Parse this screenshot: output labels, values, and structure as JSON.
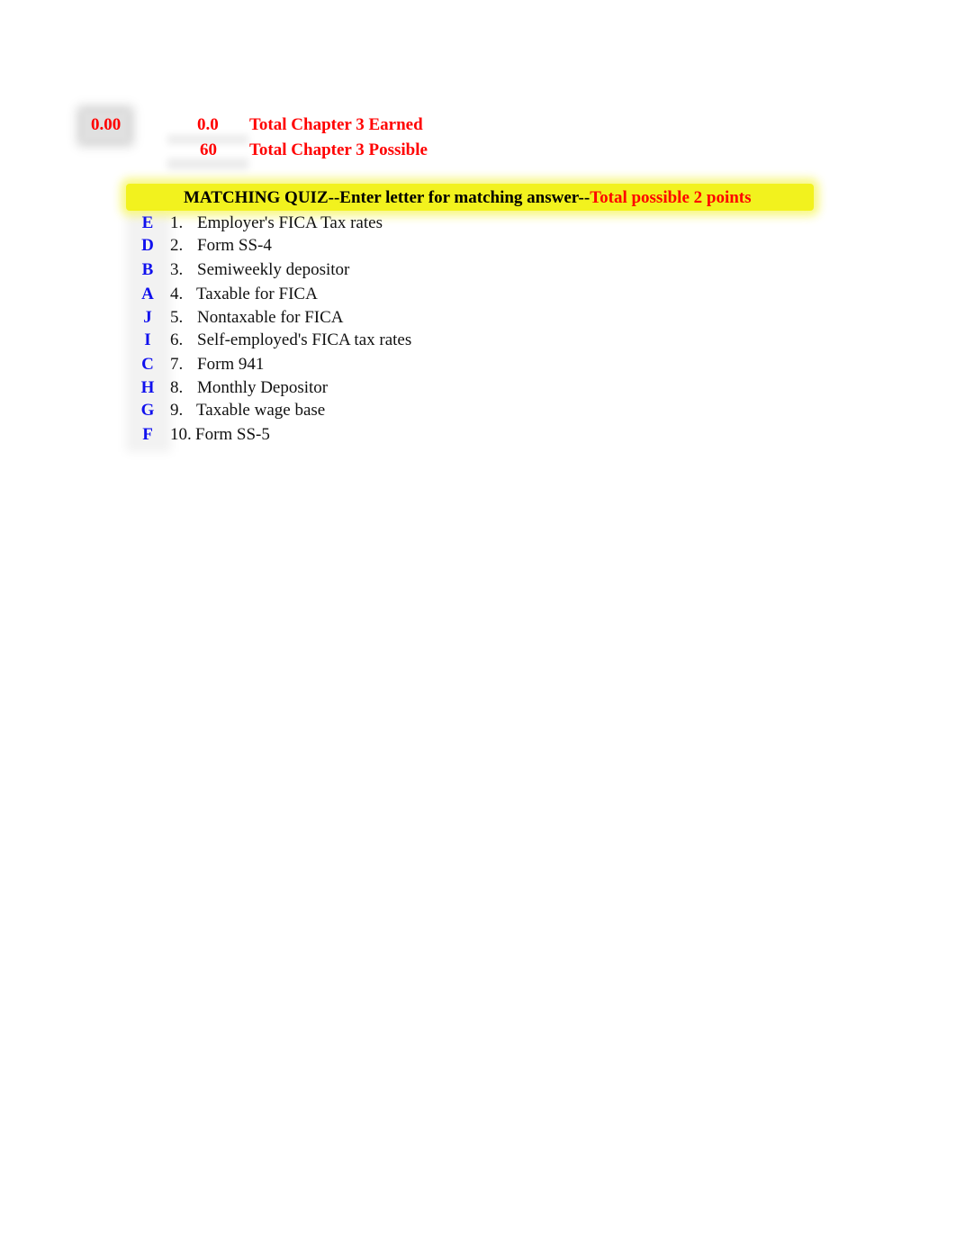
{
  "scores": {
    "percent": "0.00",
    "earned": "0.0",
    "earned_label": "Total Chapter 3 Earned",
    "possible": "60",
    "possible_label": "Total Chapter 3 Possible"
  },
  "quiz": {
    "title": "MATCHING QUIZ--Enter letter for matching answer--",
    "points_note": "Total possible 2 points",
    "items": [
      {
        "answer": "E",
        "number": "1.",
        "term": "Employer's FICA Tax rates"
      },
      {
        "answer": "D",
        "number": "2.",
        "term": "Form SS-4"
      },
      {
        "answer": "B",
        "number": "3.",
        "term": "Semiweekly depositor"
      },
      {
        "answer": "A",
        "number": "4.",
        "term": "Taxable for FICA"
      },
      {
        "answer": "J",
        "number": "5.",
        "term": "Nontaxable for FICA"
      },
      {
        "answer": "I",
        "number": "6.",
        "term": "Self-employed's FICA tax rates"
      },
      {
        "answer": "C",
        "number": "7.",
        "term": "Form 941"
      },
      {
        "answer": "H",
        "number": "8.",
        "term": "Monthly Depositor"
      },
      {
        "answer": "G",
        "number": "9.",
        "term": "Taxable wage base"
      },
      {
        "answer": "F",
        "number": "10.",
        "term": "Form SS-5"
      }
    ]
  },
  "colors": {
    "score_text": "#ff0000",
    "answer_text": "#1010ee",
    "banner_bg": "#f2f21e"
  }
}
